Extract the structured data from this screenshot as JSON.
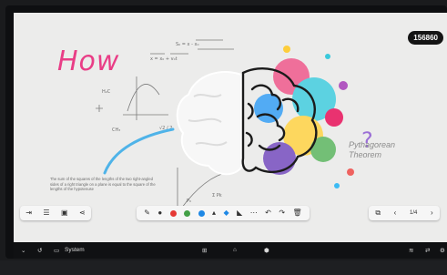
{
  "badge": "156860",
  "canvas": {
    "how_text": "How",
    "pythagorean_line1": "Pythagorean",
    "pythagorean_line2": "Theorem",
    "note_text": "The sum of the squares of the lengths of the two right-angled sides of a right triangle on a plane is equal to the square of the lengths of the hypotenuse"
  },
  "bottom_bar": {
    "system_label": "System",
    "page_indicator": "1/4"
  },
  "colors": {
    "canvas_bg": "#ececeb",
    "pen_colors": [
      "#e53935",
      "#43a047",
      "#1e88e5",
      "#2b2b2b"
    ]
  }
}
